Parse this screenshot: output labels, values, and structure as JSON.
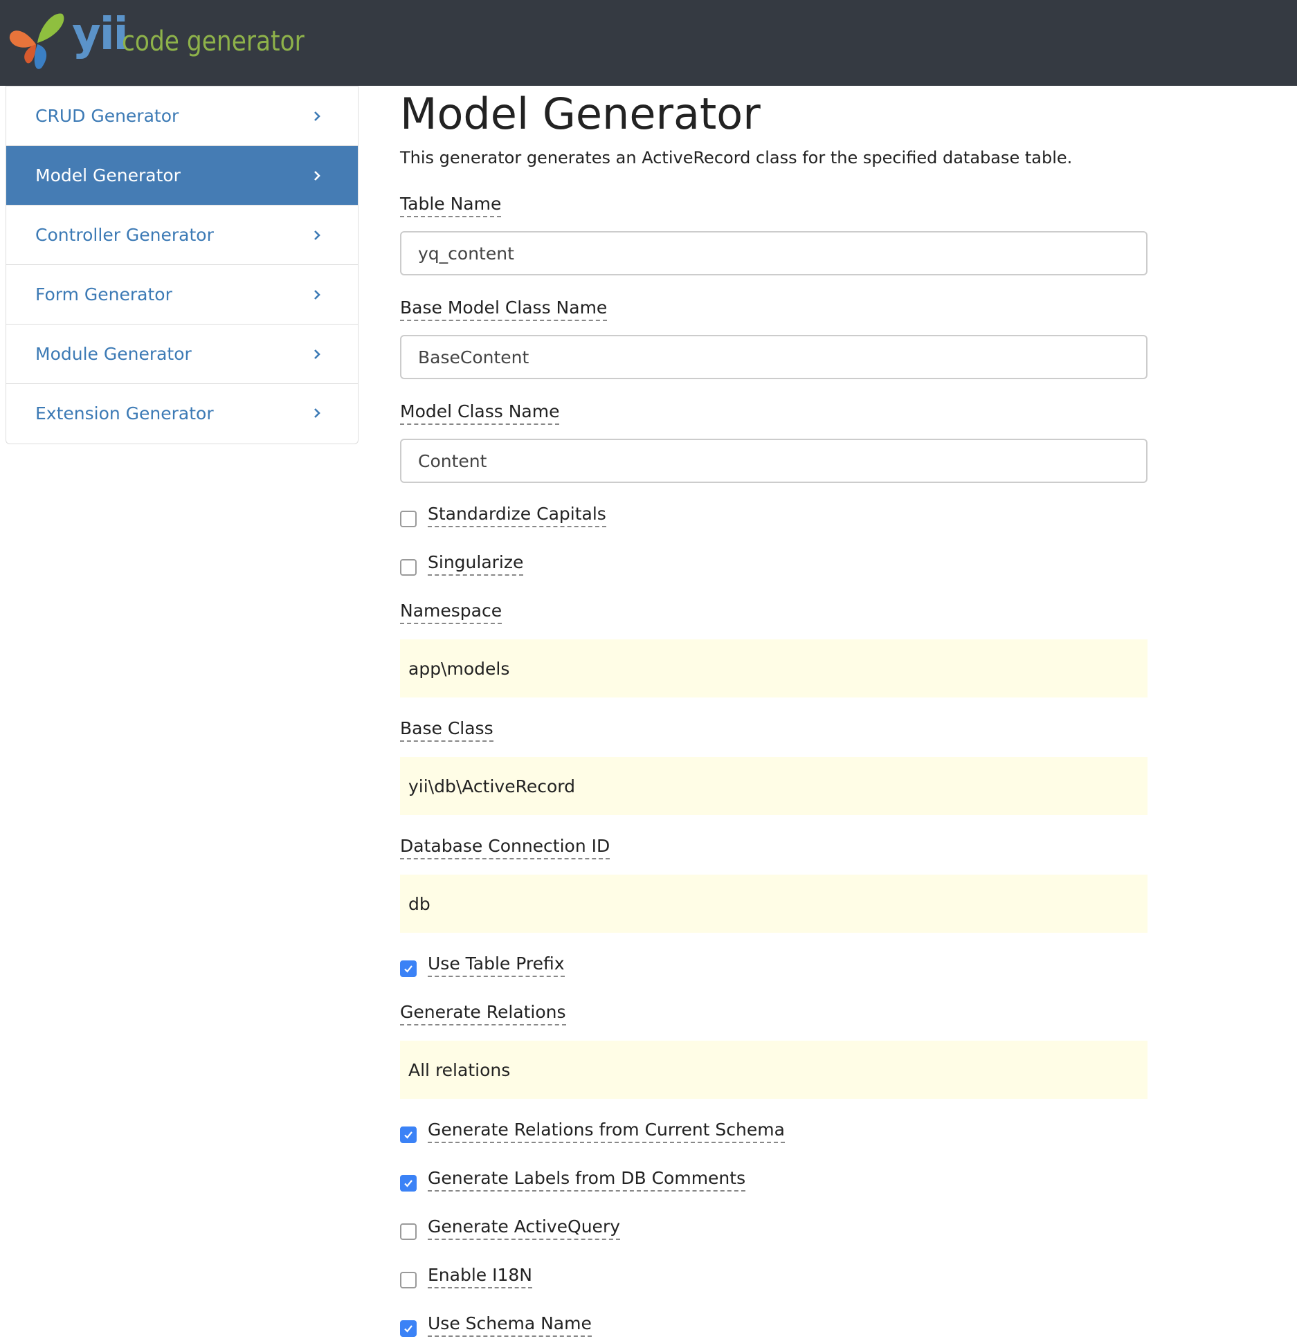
{
  "header": {
    "brand_yii": "yii",
    "brand_rest": "code generator",
    "logo_icon": "yii-butterfly-logo"
  },
  "sidebar": {
    "items": [
      {
        "label": "CRUD Generator",
        "active": false
      },
      {
        "label": "Model Generator",
        "active": true
      },
      {
        "label": "Controller Generator",
        "active": false
      },
      {
        "label": "Form Generator",
        "active": false
      },
      {
        "label": "Module Generator",
        "active": false
      },
      {
        "label": "Extension Generator",
        "active": false
      }
    ],
    "active_color": "#457cb4",
    "link_color": "#3c7ab5"
  },
  "main": {
    "title": "Model Generator",
    "description": "This generator generates an ActiveRecord class for the specified database table.",
    "fields": {
      "table_name": {
        "label": "Table Name",
        "value": "yq_content"
      },
      "base_model_class": {
        "label": "Base Model Class Name",
        "value": "BaseContent"
      },
      "model_class": {
        "label": "Model Class Name",
        "value": "Content"
      },
      "standardize_capitals": {
        "label": "Standardize Capitals",
        "checked": false
      },
      "singularize": {
        "label": "Singularize",
        "checked": false
      },
      "namespace": {
        "label": "Namespace",
        "value": "app\\models"
      },
      "base_class": {
        "label": "Base Class",
        "value": "yii\\db\\ActiveRecord"
      },
      "db_connection": {
        "label": "Database Connection ID",
        "value": "db"
      },
      "use_table_prefix": {
        "label": "Use Table Prefix",
        "checked": true
      },
      "generate_relations": {
        "label": "Generate Relations",
        "value": "All relations"
      },
      "relations_current_schema": {
        "label": "Generate Relations from Current Schema",
        "checked": true
      },
      "labels_from_db": {
        "label": "Generate Labels from DB Comments",
        "checked": true
      },
      "active_query": {
        "label": "Generate ActiveQuery",
        "checked": false
      },
      "enable_i18n": {
        "label": "Enable I18N",
        "checked": false
      },
      "use_schema_name": {
        "label": "Use Schema Name",
        "checked": true
      }
    },
    "sticky_bg": "#fffde6",
    "checkbox_color": "#3b82f6"
  }
}
